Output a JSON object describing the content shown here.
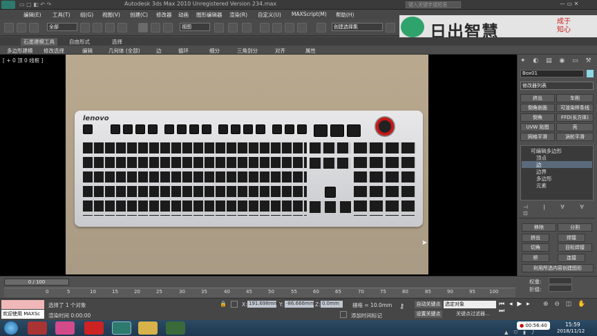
{
  "app": {
    "title": "Autodesk 3ds Max  2010    Unregistered Version    234.max",
    "search_placeholder": "键入关键字或短语"
  },
  "menu": [
    "编辑(E)",
    "工具(T)",
    "组(G)",
    "视图(V)",
    "创建(C)",
    "修改器",
    "动画",
    "图形编辑器",
    "渲染(R)",
    "自定义(U)",
    "MAXScript(M)",
    "帮助(H)"
  ],
  "toolbar": {
    "selection_filter": "全部",
    "coord_system": "视图",
    "named_selection": "创建选择集"
  },
  "brand": {
    "text": "日出智慧",
    "seal": "成于知心"
  },
  "ribbon": {
    "tabs": [
      "石墨建模工具",
      "自由形式",
      "选择"
    ]
  },
  "subtabs": [
    "多边形建模",
    "修改选择",
    "编辑",
    "几何体 (全部)",
    "边",
    "循环",
    "细分",
    "三角剖分",
    "对齐",
    "属性"
  ],
  "viewport": {
    "label": "[ + 0 顶 0 线框 ]",
    "keyboard_brand": "lenovo"
  },
  "command_panel": {
    "object_name": "Box01",
    "modifier_list": "修改器列表",
    "modifier_buttons": [
      "挤出",
      "车削",
      "倒角剖面",
      "可渲染样条线",
      "倒角",
      "FFD(长方体)",
      "UVW 贴图",
      "壳",
      "网格平滑",
      "涡轮平滑"
    ],
    "stack": [
      "可编辑多边形",
      "顶点",
      "边",
      "边界",
      "多边形",
      "元素"
    ],
    "edit_edges": {
      "remove": "移除",
      "split": "分割",
      "extrude": "挤出",
      "weld": "焊接",
      "chamfer": "切角",
      "target_weld": "目标焊接",
      "bridge": "桥",
      "connect": "连接",
      "create_shape": "利用所选内容创建图形",
      "weight": "权重:",
      "crease": "折缝:"
    }
  },
  "timeline": {
    "frame": "0 / 100",
    "ticks": [
      "0",
      "5",
      "10",
      "15",
      "20",
      "25",
      "30",
      "35",
      "40",
      "45",
      "50",
      "55",
      "60",
      "65",
      "70",
      "75",
      "80",
      "85",
      "90",
      "95",
      "100"
    ]
  },
  "status": {
    "welcome": "欢迎使用 MAXSc",
    "selected": "选择了 1 个对象",
    "render_time": "渲染时间  0:00:00",
    "x_label": "X:",
    "x_value": "191.698mm",
    "y_label": "Y:",
    "y_value": "-86.666mm",
    "z_label": "Z:",
    "z_value": "0.0mm",
    "grid": "栅格 = 10.0mm",
    "add_time_tag": "添加时间标记",
    "auto_key": "自动关键点",
    "set_key": "设置关键点",
    "selected_object": "选定对象",
    "key_filters": "关键点过滤器..."
  },
  "taskbar": {
    "recording": "00:56:40",
    "time": "15:59",
    "date": "2018/11/12"
  }
}
